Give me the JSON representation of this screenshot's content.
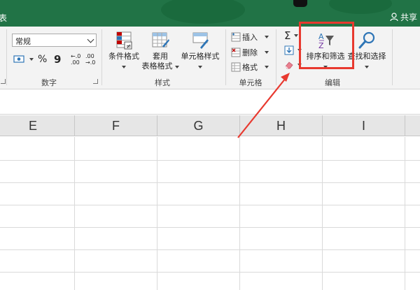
{
  "titlebar": {
    "left_text": "表",
    "share_label": "共享"
  },
  "number_group": {
    "format_value": "常规",
    "percent_symbol": "%",
    "comma_symbol": "9",
    "inc_decimal": "←.0\n.00",
    "dec_decimal": ".00\n→.0",
    "label": "数字"
  },
  "styles_group": {
    "conditional_format": "条件格式",
    "table_format_line1": "套用",
    "table_format_line2": "表格格式",
    "cell_styles": "单元格样式",
    "label": "样式"
  },
  "cells_group": {
    "insert": "插入",
    "delete": "删除",
    "format": "格式",
    "label": "单元格"
  },
  "editing_group": {
    "sort_filter": "排序和筛选",
    "find_select": "查找和选择",
    "label": "编辑"
  },
  "columns": [
    "E",
    "F",
    "G",
    "H",
    "I"
  ],
  "colors": {
    "excel_green": "#217346",
    "highlight_red": "#e8392f",
    "header_gray": "#e6e6e6"
  },
  "icons": [
    "fill-color-icon",
    "autosum-icon",
    "fill-down-icon",
    "eraser-icon",
    "sort-filter-icon",
    "search-icon",
    "user-icon"
  ]
}
